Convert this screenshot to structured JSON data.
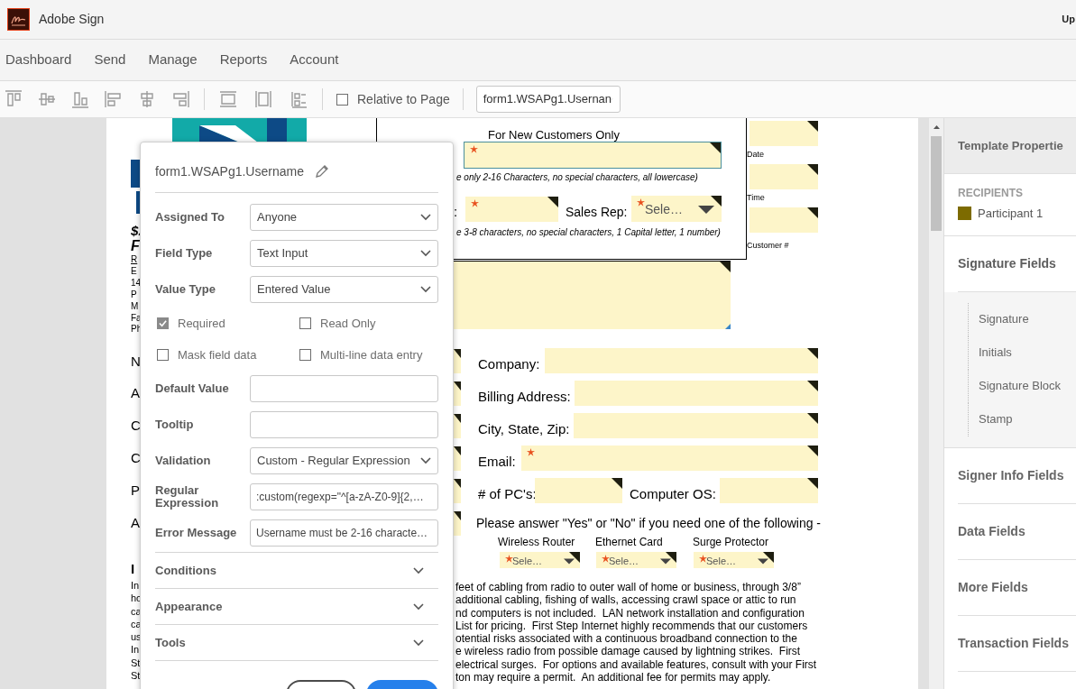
{
  "app": {
    "title": "Adobe Sign",
    "header_edge_text": "Up"
  },
  "nav": [
    {
      "label": "Dashboard"
    },
    {
      "label": "Send"
    },
    {
      "label": "Manage"
    },
    {
      "label": "Reports"
    },
    {
      "label": "Account"
    }
  ],
  "toolbar": {
    "relative_to_page": {
      "label": "Relative to Page",
      "checked": false
    },
    "field_select": "form1.WSAPg1.Usernan"
  },
  "document": {
    "heading": "For New Customers Only",
    "username_field": {
      "required": true,
      "selected": true
    },
    "username_hint": "e only 2-16 Characters, no special characters, all lowercase)",
    "password_label": ":",
    "password_field": {
      "required": true
    },
    "sales_rep": {
      "label": "Sales Rep:",
      "value": "Sele…",
      "required": true
    },
    "password_hint": "e 3-8 characters, no special characters, 1 Capital letter, 1 number)",
    "side_fields": [
      {
        "label": "Date"
      },
      {
        "label": "Time"
      },
      {
        "label": "Customer #"
      }
    ],
    "left_fragments": [
      {
        "text": "$.",
        "kind": "bold"
      },
      {
        "text": "F",
        "kind": "title"
      },
      {
        "text": "R",
        "kind": "underline"
      },
      {
        "text": "E",
        "kind": "small"
      },
      {
        "text": "14",
        "kind": "small"
      },
      {
        "text": "P",
        "kind": "small"
      },
      {
        "text": "M",
        "kind": "small"
      },
      {
        "text": "Fa",
        "kind": "small"
      },
      {
        "text": "Ph",
        "kind": "small"
      },
      {
        "text": "N",
        "kind": "label"
      },
      {
        "text": "A",
        "kind": "label"
      },
      {
        "text": "C",
        "kind": "label"
      },
      {
        "text": "C",
        "kind": "label"
      },
      {
        "text": "P",
        "kind": "label"
      },
      {
        "text": "A",
        "kind": "label"
      },
      {
        "text": "I",
        "kind": "heading"
      },
      {
        "text": "In",
        "kind": "body"
      },
      {
        "text": "ho",
        "kind": "body"
      },
      {
        "text": "ca",
        "kind": "body"
      },
      {
        "text": "ca",
        "kind": "body"
      },
      {
        "text": "us",
        "kind": "body"
      },
      {
        "text": "In",
        "kind": "body"
      },
      {
        "text": "St",
        "kind": "body"
      },
      {
        "text": "St",
        "kind": "body"
      }
    ],
    "rows": [
      {
        "fields": [
          {
            "label": "Company:",
            "required": false
          }
        ]
      },
      {
        "fields": [
          {
            "label": "Billing Address:",
            "required": false
          }
        ]
      },
      {
        "fields": [
          {
            "label": "City, State, Zip:",
            "required": false
          }
        ]
      },
      {
        "fields": [
          {
            "label": "Email:",
            "required": true
          }
        ]
      },
      {
        "fields": [
          {
            "label": "# of PC's:",
            "required": false
          },
          {
            "label": "Computer OS:",
            "required": false
          }
        ]
      }
    ],
    "question": "Please answer \"Yes\" or \"No\" if you need one of the following -",
    "options": [
      {
        "label": "Wireless Router",
        "value": "Sele…",
        "required": true
      },
      {
        "label": "Ethernet Card",
        "value": "Sele…",
        "required": true
      },
      {
        "label": "Surge Protector",
        "value": "Sele…",
        "required": true
      }
    ],
    "paragraph_lines": [
      "feet of cabling from radio to outer wall of home or business, through 3/8”",
      "additional cabling, fishing of walls, accessing crawl space or attic to run",
      "nd computers is not included.  LAN network installation and configuration",
      "List for pricing.  First Step Internet highly recommends that our customers",
      "otential risks associated with a continuous broadband connection to the",
      "e wireless radio from possible damage caused by lightning strikes.  First",
      "electrical surges.  For options and available features, consult with your First",
      "ton may require a permit.  An additional fee for permits may apply."
    ]
  },
  "field_popover": {
    "title": "form1.WSAPg1.Username",
    "rows": [
      {
        "kind": "select",
        "label": "Assigned To",
        "value": "Anyone"
      },
      {
        "kind": "select",
        "label": "Field Type",
        "value": "Text Input"
      },
      {
        "kind": "select",
        "label": "Value Type",
        "value": "Entered Value"
      },
      {
        "kind": "checkboxes",
        "items": [
          {
            "label": "Required",
            "checked": true
          },
          {
            "label": "Read Only",
            "checked": false
          }
        ]
      },
      {
        "kind": "checkboxes",
        "items": [
          {
            "label": "Mask field data",
            "checked": false
          },
          {
            "label": "Multi-line data entry",
            "checked": false
          }
        ]
      },
      {
        "kind": "input",
        "label": "Default Value"
      },
      {
        "kind": "input",
        "label": "Tooltip"
      },
      {
        "kind": "select",
        "label": "Validation",
        "value": "Custom - Regular Expression"
      },
      {
        "kind": "input",
        "label": "Regular Expression",
        "value": ":custom(regexp=\"^[a-zA-Z0-9]{2,…"
      },
      {
        "kind": "input",
        "label": "Error Message",
        "value": "Username must be 2-16 characte…"
      }
    ],
    "sections": [
      {
        "label": "Conditions",
        "expanded": false
      },
      {
        "label": "Appearance",
        "expanded": false
      },
      {
        "label": "Tools",
        "expanded": false
      }
    ],
    "buttons": [
      {
        "kind": "outline"
      },
      {
        "kind": "primary"
      }
    ]
  },
  "right_panel": {
    "header": "Template Propertie",
    "recipients_label": "RECIPIENTS",
    "recipients": [
      {
        "name": "Participant 1",
        "color": "#7d6b00"
      }
    ],
    "sections": [
      {
        "label": "Signature Fields",
        "expanded": true,
        "items": [
          {
            "label": "Signature"
          },
          {
            "label": "Initials"
          },
          {
            "label": "Signature Block"
          },
          {
            "label": "Stamp"
          }
        ]
      },
      {
        "label": "Signer Info Fields",
        "expanded": false
      },
      {
        "label": "Data Fields",
        "expanded": false
      },
      {
        "label": "More Fields",
        "expanded": false
      },
      {
        "label": "Transaction Fields",
        "expanded": false
      }
    ]
  }
}
